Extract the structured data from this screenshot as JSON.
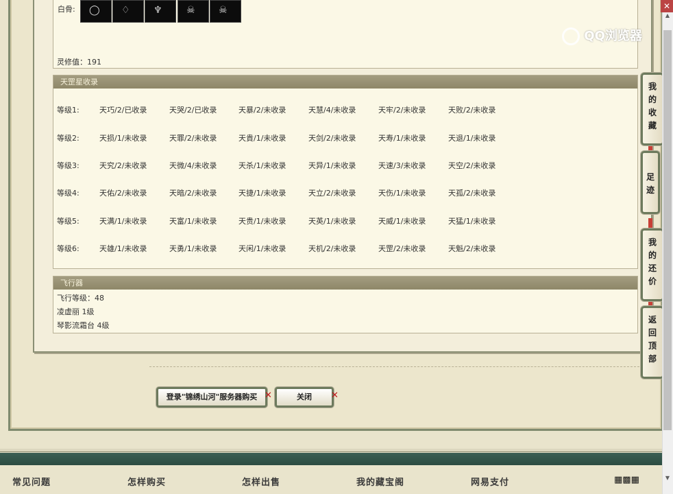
{
  "gems": {
    "label": "白骨:",
    "items": [
      {
        "icon": "bracelet-icon"
      },
      {
        "icon": "pendant-icon"
      },
      {
        "icon": "demon-mask-icon"
      },
      {
        "icon": "skull-ring-icon"
      },
      {
        "icon": "skull-ring-icon"
      }
    ]
  },
  "lingxiu": "灵修值：191",
  "tiangang": {
    "header": "天罡星收录",
    "grades": [
      {
        "label": "等级1:",
        "cells": [
          "天巧/2/已收录",
          "天哭/2/已收录",
          "天暴/2/未收录",
          "天慧/4/未收录",
          "天牢/2/未收录",
          "天败/2/未收录"
        ]
      },
      {
        "label": "等级2:",
        "cells": [
          "天损/1/未收录",
          "天罪/2/未收录",
          "天貴/1/未收录",
          "天剑/2/未收录",
          "天寿/1/未收录",
          "天退/1/未收录"
        ]
      },
      {
        "label": "等级3:",
        "cells": [
          "天究/2/未收录",
          "天微/4/未收录",
          "天杀/1/未收录",
          "天异/1/未收录",
          "天速/3/未收录",
          "天空/2/未收录"
        ]
      },
      {
        "label": "等级4:",
        "cells": [
          "天佑/2/未收录",
          "天暗/2/未收录",
          "天捷/1/未收录",
          "天立/2/未收录",
          "天伤/1/未收录",
          "天孤/2/未收录"
        ]
      },
      {
        "label": "等级5:",
        "cells": [
          "天满/1/未收录",
          "天富/1/未收录",
          "天贵/1/未收录",
          "天英/1/未收录",
          "天威/1/未收录",
          "天猛/1/未收录"
        ]
      },
      {
        "label": "等级6:",
        "cells": [
          "天雄/1/未收录",
          "天勇/1/未收录",
          "天闲/1/未收录",
          "天机/2/未收录",
          "天罡/2/未收录",
          "天魁/2/未收录"
        ]
      }
    ]
  },
  "fly": {
    "header": "飞行器",
    "lines": [
      "飞行等级：48",
      "凌虚丽   1级",
      "琴影流霜台   4级"
    ]
  },
  "buttons": {
    "login_buy": "登录\"锦绣山河\"服务器购买",
    "close": "关闭"
  },
  "side_tabs": {
    "favorites": "我的收藏",
    "footprint": "足迹",
    "my_bargain": "我的还价",
    "back_top": "返回顶部"
  },
  "watermark": "QQ浏览器",
  "footer": {
    "nav": [
      "常见问题",
      "怎样购买",
      "怎样出售",
      "我的藏宝阁",
      "网易支付"
    ]
  }
}
